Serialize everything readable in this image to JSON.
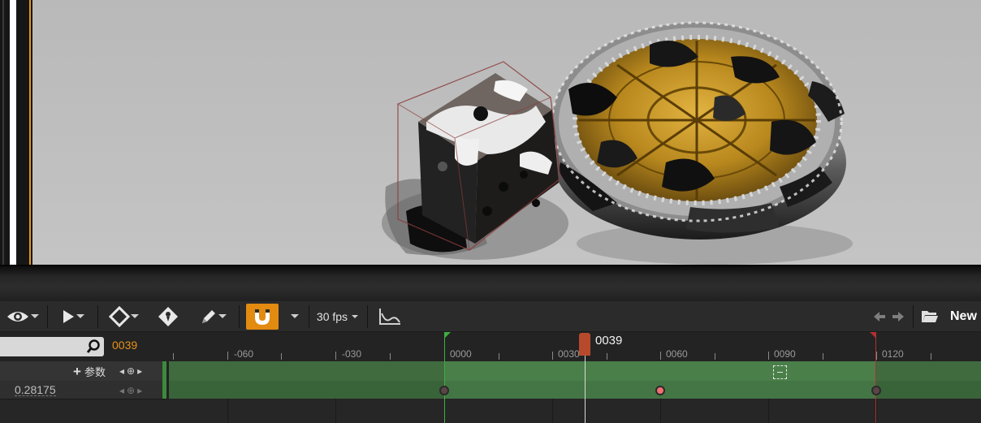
{
  "toolbar": {
    "fps_label": "30 fps",
    "asset_label": "New"
  },
  "search": {
    "placeholder": "",
    "current_frame": "0039"
  },
  "track": {
    "add_label": "参数",
    "value": "0.28175"
  },
  "ruler": {
    "labels": [
      "-060",
      "-030",
      "0000",
      "0030",
      "0060",
      "0090",
      "0120"
    ]
  },
  "playhead": {
    "frame": "0039"
  },
  "colors": {
    "accent_orange": "#e38a10",
    "playhead_red": "#b84a2c",
    "track_green": "#4a7f4a",
    "start_marker": "#3fae3f",
    "end_marker": "#b03030",
    "key_red": "#f07070"
  },
  "icons": [
    "eye-icon",
    "play-icon",
    "keyframe-icon",
    "tag-icon",
    "pencil-icon",
    "magnet-icon",
    "curve-editor-icon",
    "back-arrow-icon",
    "forward-arrow-icon",
    "folder-icon",
    "search-icon"
  ]
}
